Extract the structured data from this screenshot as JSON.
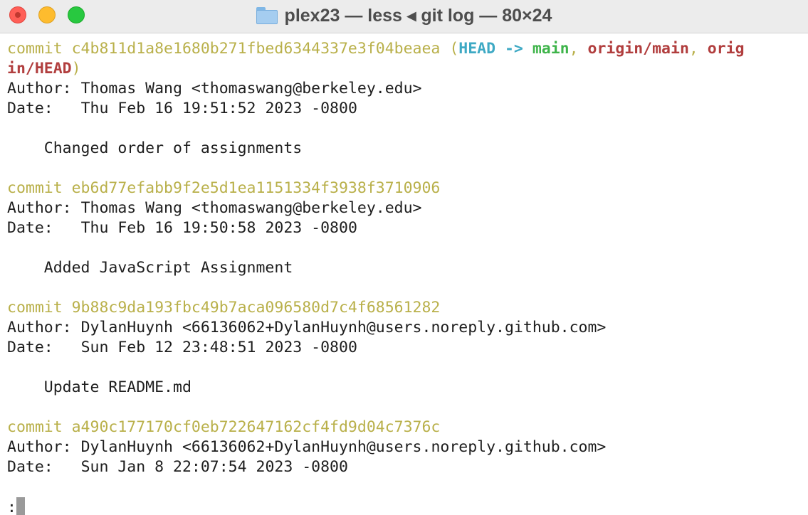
{
  "window": {
    "title": "plex23 — less ◂ git log — 80×24",
    "folder_icon": "folder-icon",
    "traffic_lights": {
      "close_color": "#ff5f57",
      "minimize_color": "#febc2e",
      "zoom_color": "#28c840"
    }
  },
  "colors": {
    "commit_hash": "#b9b04a",
    "head": "#3ea9c4",
    "branch": "#3eb44a",
    "remote": "#b13e3e"
  },
  "commits": [
    {
      "commit_prefix": "commit ",
      "hash": "c4b811d1a8e1680b271fbed6344337e3f04beaea",
      "refs": {
        "open": " (",
        "head": "HEAD -> ",
        "branch": "main",
        "sep1": ", ",
        "remote_main_line1": "origin/main",
        "sep2": ", ",
        "remote_head_part1": "orig",
        "remote_head_part2": "in/HEAD",
        "close": ")"
      },
      "author_label": "Author: ",
      "author": "Thomas Wang <thomaswang@berkeley.edu>",
      "date_label": "Date:   ",
      "date": "Thu Feb 16 19:51:52 2023 -0800",
      "message": "    Changed order of assignments"
    },
    {
      "commit_prefix": "commit ",
      "hash": "eb6d77efabb9f2e5d1ea1151334f3938f3710906",
      "author_label": "Author: ",
      "author": "Thomas Wang <thomaswang@berkeley.edu>",
      "date_label": "Date:   ",
      "date": "Thu Feb 16 19:50:58 2023 -0800",
      "message": "    Added JavaScript Assignment"
    },
    {
      "commit_prefix": "commit ",
      "hash": "9b88c9da193fbc49b7aca096580d7c4f68561282",
      "author_label": "Author: ",
      "author": "DylanHuynh <66136062+DylanHuynh@users.noreply.github.com>",
      "date_label": "Date:   ",
      "date": "Sun Feb 12 23:48:51 2023 -0800",
      "message": "    Update README.md"
    },
    {
      "commit_prefix": "commit ",
      "hash": "a490c177170cf0eb722647162cf4fd9d04c7376c",
      "author_label": "Author: ",
      "author": "DylanHuynh <66136062+DylanHuynh@users.noreply.github.com>",
      "date_label": "Date:   ",
      "date": "Sun Jan 8 22:07:54 2023 -0800"
    }
  ],
  "pager": {
    "prompt": ":"
  }
}
